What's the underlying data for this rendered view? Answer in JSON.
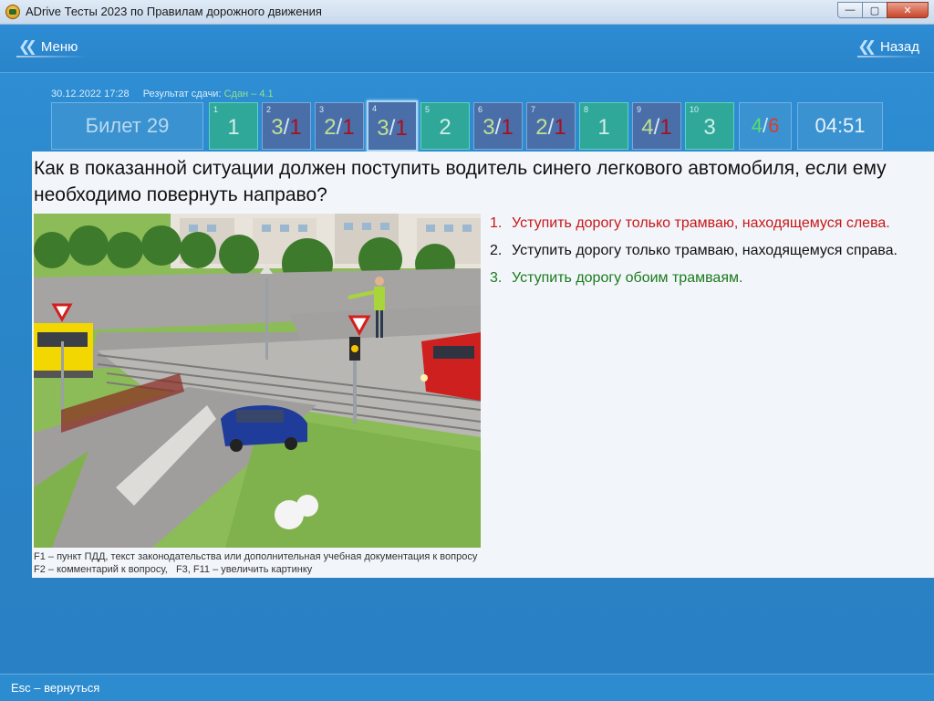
{
  "window": {
    "title": "ADrive Тесты 2023 по Правилам дорожного движения",
    "min_glyph": "—",
    "max_glyph": "▢",
    "close_glyph": "✕"
  },
  "nav": {
    "menu_label": "Меню",
    "back_label": "Назад"
  },
  "session": {
    "datetime": "30.12.2022 17:28",
    "result_label": "Результат сдачи:",
    "result_value": "Сдан – 4.1"
  },
  "ticket": {
    "label": "Билет 29"
  },
  "questions": [
    {
      "num": "1",
      "answer": "1"
    },
    {
      "num": "2",
      "answer_given": "3",
      "answer_correct": "1"
    },
    {
      "num": "3",
      "answer_given": "2",
      "answer_correct": "1"
    },
    {
      "num": "4",
      "answer_given": "3",
      "answer_correct": "1"
    },
    {
      "num": "5",
      "answer": "2"
    },
    {
      "num": "6",
      "answer_given": "3",
      "answer_correct": "1"
    },
    {
      "num": "7",
      "answer_given": "2",
      "answer_correct": "1"
    },
    {
      "num": "8",
      "answer": "1"
    },
    {
      "num": "9",
      "answer_given": "4",
      "answer_correct": "1"
    },
    {
      "num": "10",
      "answer": "3"
    }
  ],
  "score": {
    "correct": "4",
    "wrong": "6",
    "separator": "/"
  },
  "timer": "04:51",
  "question": {
    "text": "Как в показанной ситуации должен поступить водитель синего легкового автомобиля, если ему необходимо повернуть направо?",
    "answers": [
      {
        "num": "1.",
        "text": "Уступить дорогу только трамваю, находящемуся слева."
      },
      {
        "num": "2.",
        "text": "Уступить дорогу только трамваю, находящемуся справа."
      },
      {
        "num": "3.",
        "text": "Уступить дорогу обоим трамваям."
      }
    ]
  },
  "hints": {
    "line1": "F1 – пункт ПДД, текст законодательства или дополнительная учебная документация к вопросу",
    "line2": "F2 – комментарий к вопросу,   F3, F11 – увеличить картинку"
  },
  "footer": {
    "esc_label": "Esc – вернуться"
  },
  "colors": {
    "background": "#2a86c8",
    "answered_correct": "#2fa89a",
    "answered_wrong": "#4a6fa8",
    "wrong_digit": "#a61020",
    "answer_wrong_text": "#c81818",
    "answer_right_text": "#1b7a1b"
  },
  "icons": [
    "app-logo-icon",
    "chevron-left-icon",
    "minimize-icon",
    "maximize-icon",
    "close-icon"
  ]
}
